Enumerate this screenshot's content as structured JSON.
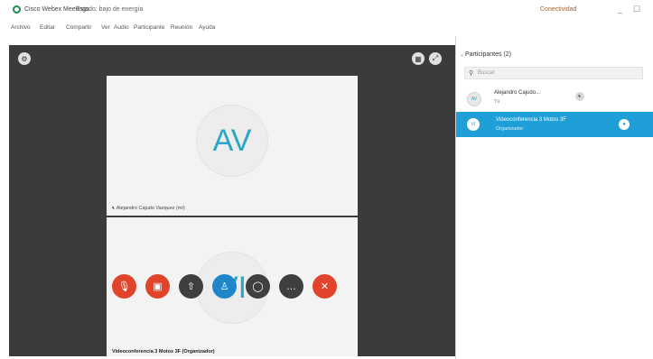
{
  "titlebar": {
    "app_title": "Cisco Webex Meetings",
    "status": "Estado: bajo de energía",
    "connection": "Conectividad",
    "minimize": "_",
    "maximize": "☐"
  },
  "menu": [
    "Archivo",
    "Editar",
    "Compartir",
    "Ver",
    "Audio",
    "Participante",
    "Reunión",
    "Ayuda"
  ],
  "video": {
    "tile1": {
      "initials": "AV",
      "name": "Alejandro Cajudo Vazquez (mí)"
    },
    "tile2": {
      "initials": "VI",
      "name": "Videoconferencia 3 Motos 3F (Organizador)"
    }
  },
  "controls": [
    {
      "name": "mute-button",
      "icon": "microphone-muted-icon",
      "glyph": "🎙",
      "color": "#e0452b"
    },
    {
      "name": "video-button",
      "icon": "video-off-icon",
      "glyph": "▣",
      "color": "#e0452b"
    },
    {
      "name": "share-button",
      "icon": "share-icon",
      "glyph": "⇧",
      "color": "#3f3f3f"
    },
    {
      "name": "participants-button",
      "icon": "participants-icon",
      "glyph": "♙",
      "color": "#1f86c9"
    },
    {
      "name": "chat-button",
      "icon": "chat-icon",
      "glyph": "◯",
      "color": "#3f3f3f"
    },
    {
      "name": "more-button",
      "icon": "more-icon",
      "glyph": "…",
      "color": "#3f3f3f"
    },
    {
      "name": "end-meeting-button",
      "icon": "close-icon",
      "glyph": "✕",
      "color": "#e0452b"
    }
  ],
  "panel": {
    "title": "Participantes (2)",
    "search_placeholder": "Buscar",
    "participants": [
      {
        "initials": "AV",
        "name": "Alejandro Cajudo...",
        "role": "Tú"
      },
      {
        "initials": "VI",
        "name": "Videoconferencia 3 Motos 3F",
        "role": "Organizador"
      }
    ]
  }
}
